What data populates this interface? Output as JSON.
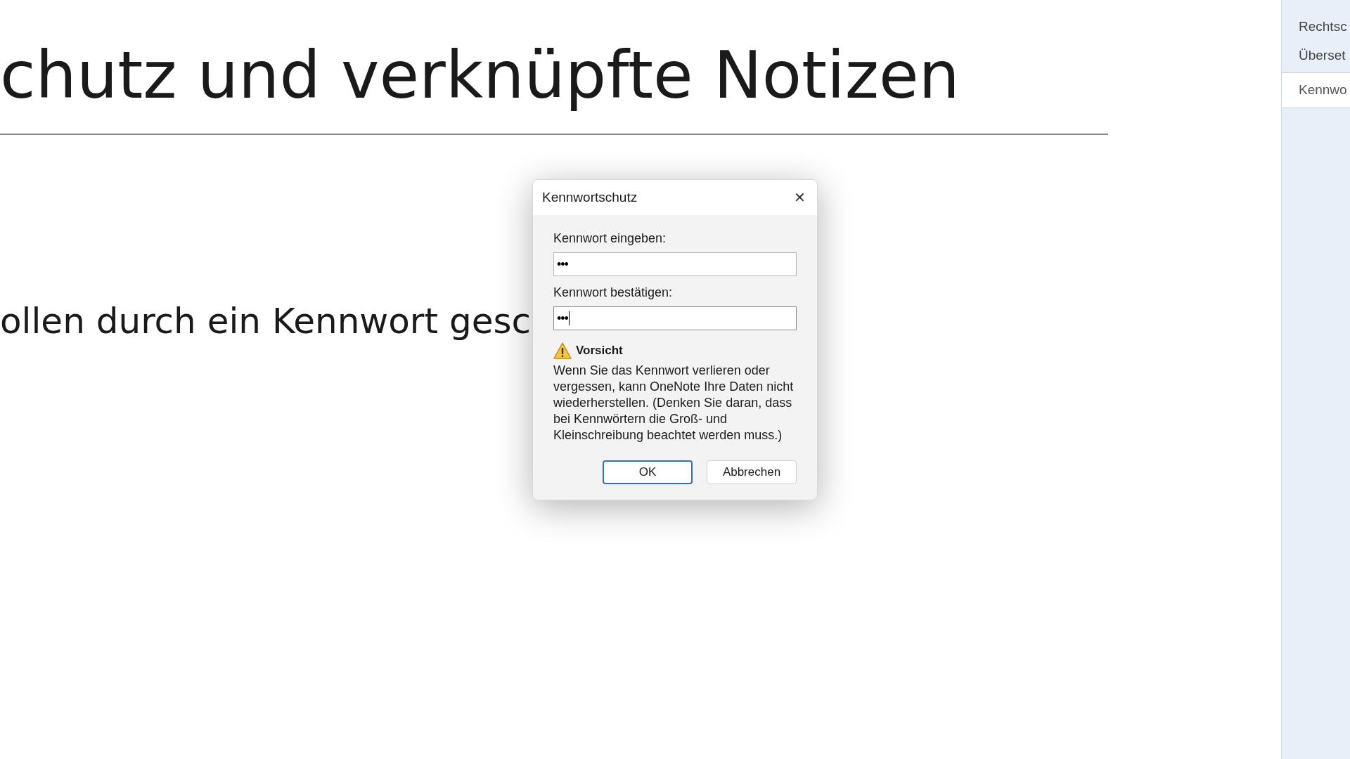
{
  "page": {
    "title": "chutz und verknüpfte Notizen",
    "body_text": "ollen durch ein Kennwort gesc"
  },
  "side_panel": {
    "group_items": [
      "Rechtsc",
      "Überset"
    ],
    "label": "Kennwo"
  },
  "dialog": {
    "title": "Kennwortschutz",
    "close": "✕",
    "fields": [
      {
        "label": "Kennwort eingeben:",
        "value": "•••",
        "focused": false
      },
      {
        "label": "Kennwort bestätigen:",
        "value": "•••",
        "focused": true
      }
    ],
    "warning": {
      "title": "Vorsicht",
      "text": "Wenn Sie das Kennwort verlieren oder vergessen, kann OneNote Ihre Daten nicht wiederherstellen. (Denken Sie daran, dass bei Kennwörtern die Groß- und Kleinschreibung beachtet werden muss.)"
    },
    "buttons": [
      {
        "label": "OK",
        "default": true
      },
      {
        "label": "Abbrechen",
        "default": false
      }
    ]
  }
}
